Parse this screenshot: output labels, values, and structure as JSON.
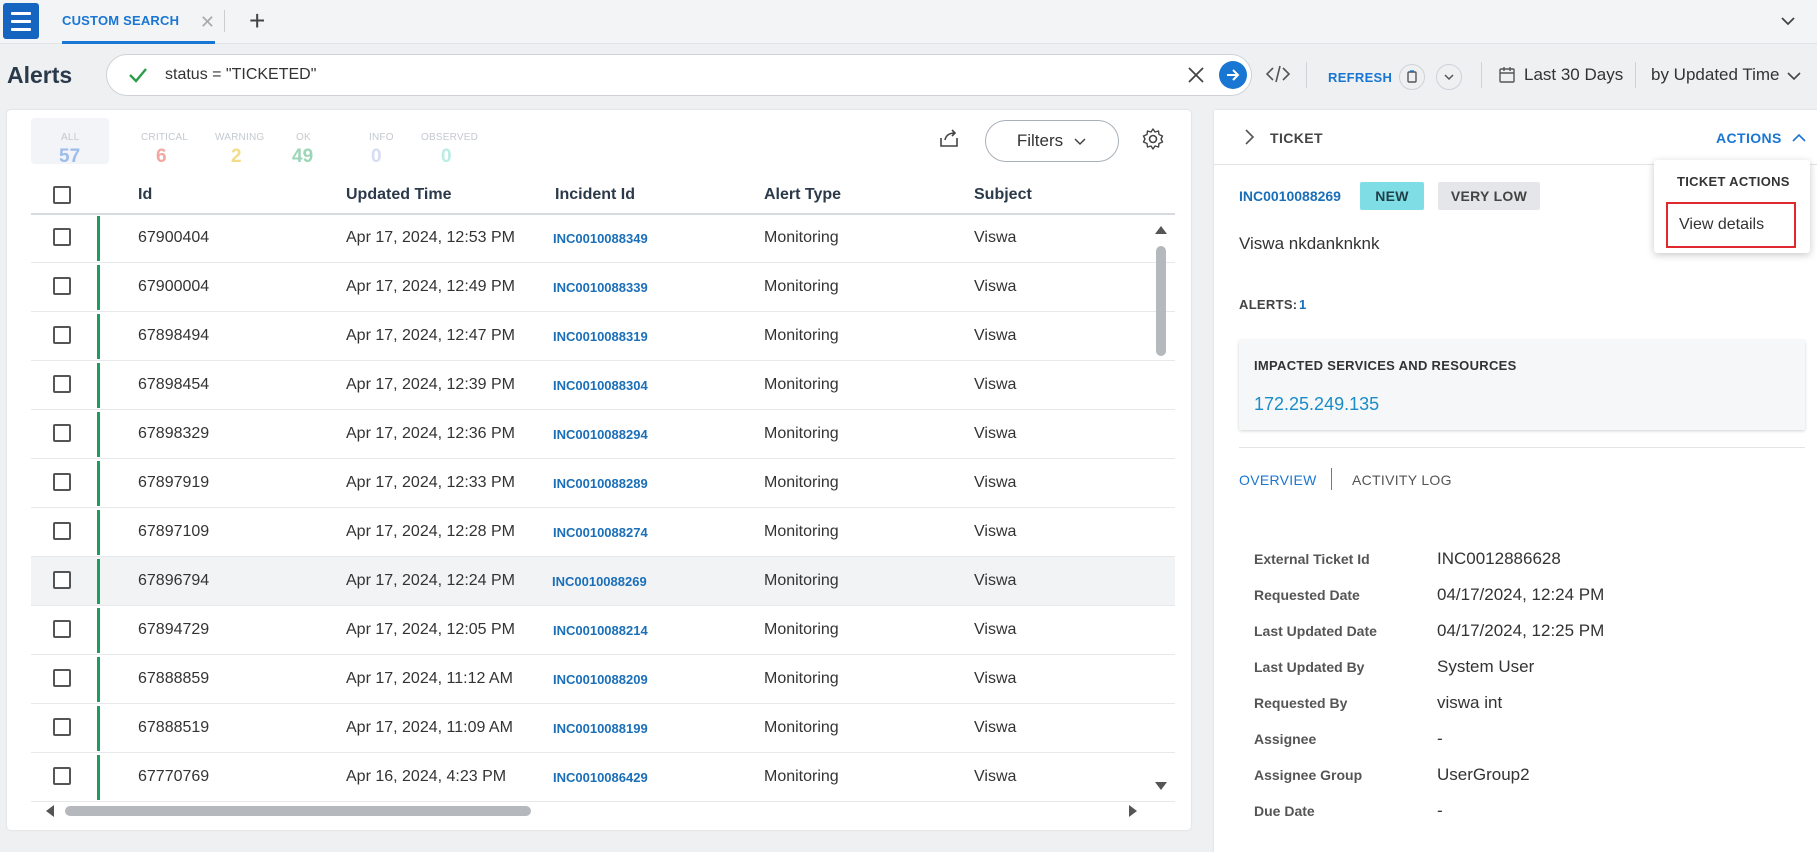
{
  "tabs": {
    "active_label": "CUSTOM SEARCH"
  },
  "header": {
    "title": "Alerts",
    "query": "status = \"TICKETED\"",
    "refresh_label": "REFRESH",
    "time_range": "Last 30 Days",
    "sort_by": "by Updated Time"
  },
  "counts": [
    {
      "label": "ALL",
      "value": "57",
      "color": "#9dbcea"
    },
    {
      "label": "CRITICAL",
      "value": "6",
      "color": "#f2a7a0"
    },
    {
      "label": "WARNING",
      "value": "2",
      "color": "#f4dc8a"
    },
    {
      "label": "OK",
      "value": "49",
      "color": "#9cd6b8"
    },
    {
      "label": "INFO",
      "value": "0",
      "color": "#d6dcf2"
    },
    {
      "label": "OBSERVED",
      "value": "0",
      "color": "#b8ece4"
    }
  ],
  "toolbar": {
    "filters_label": "Filters"
  },
  "table": {
    "columns": [
      "Id",
      "Updated Time",
      "Incident Id",
      "Alert Type",
      "Subject"
    ],
    "rows": [
      {
        "id": "67900404",
        "updated": "Apr 17, 2024, 12:53 PM",
        "incident": "INC0010088349",
        "type": "Monitoring",
        "subject": "Viswa"
      },
      {
        "id": "67900004",
        "updated": "Apr 17, 2024, 12:49 PM",
        "incident": "INC0010088339",
        "type": "Monitoring",
        "subject": "Viswa"
      },
      {
        "id": "67898494",
        "updated": "Apr 17, 2024, 12:47 PM",
        "incident": "INC0010088319",
        "type": "Monitoring",
        "subject": "Viswa"
      },
      {
        "id": "67898454",
        "updated": "Apr 17, 2024, 12:39 PM",
        "incident": "INC0010088304",
        "type": "Monitoring",
        "subject": "Viswa"
      },
      {
        "id": "67898329",
        "updated": "Apr 17, 2024, 12:36 PM",
        "incident": "INC0010088294",
        "type": "Monitoring",
        "subject": "Viswa"
      },
      {
        "id": "67897919",
        "updated": "Apr 17, 2024, 12:33 PM",
        "incident": "INC0010088289",
        "type": "Monitoring",
        "subject": "Viswa"
      },
      {
        "id": "67897109",
        "updated": "Apr 17, 2024, 12:28 PM",
        "incident": "INC0010088274",
        "type": "Monitoring",
        "subject": "Viswa"
      },
      {
        "id": "67896794",
        "updated": "Apr 17, 2024, 12:24 PM",
        "incident": "INC0010088269",
        "type": "Monitoring",
        "subject": "Viswa"
      },
      {
        "id": "67894729",
        "updated": "Apr 17, 2024, 12:05 PM",
        "incident": "INC0010088214",
        "type": "Monitoring",
        "subject": "Viswa"
      },
      {
        "id": "67888859",
        "updated": "Apr 17, 2024, 11:12 AM",
        "incident": "INC0010088209",
        "type": "Monitoring",
        "subject": "Viswa"
      },
      {
        "id": "67888519",
        "updated": "Apr 17, 2024, 11:09 AM",
        "incident": "INC0010088199",
        "type": "Monitoring",
        "subject": "Viswa"
      },
      {
        "id": "67770769",
        "updated": "Apr 16, 2024, 4:23 PM",
        "incident": "INC0010086429",
        "type": "Monitoring",
        "subject": "Viswa"
      }
    ]
  },
  "ticket": {
    "panel_title": "TICKET",
    "actions_label": "ACTIONS",
    "incident_id": "INC0010088269",
    "status": "NEW",
    "priority": "VERY LOW",
    "subject": "Viswa nkdanknknk",
    "alerts_label": "ALERTS:",
    "alerts_count": "1",
    "impacted_title": "IMPACTED SERVICES AND RESOURCES",
    "impacted_value": "172.25.249.135",
    "tab_overview": "OVERVIEW",
    "tab_activity": "ACTIVITY LOG",
    "details": [
      {
        "label": "External Ticket Id",
        "value": "INC0012886628"
      },
      {
        "label": "Requested Date",
        "value": "04/17/2024, 12:24 PM"
      },
      {
        "label": "Last Updated Date",
        "value": "04/17/2024, 12:25 PM"
      },
      {
        "label": "Last Updated By",
        "value": "System User"
      },
      {
        "label": "Requested By",
        "value": "viswa int"
      },
      {
        "label": "Assignee",
        "value": "-"
      },
      {
        "label": "Assignee Group",
        "value": "UserGroup2"
      },
      {
        "label": "Due Date",
        "value": "-"
      }
    ]
  },
  "actions_menu": {
    "title": "TICKET ACTIONS",
    "items": [
      "View details"
    ]
  },
  "colors": {
    "accent": "#1976d2",
    "status_bar": "#1a9e5e",
    "highlight_border": "#e0282e"
  }
}
